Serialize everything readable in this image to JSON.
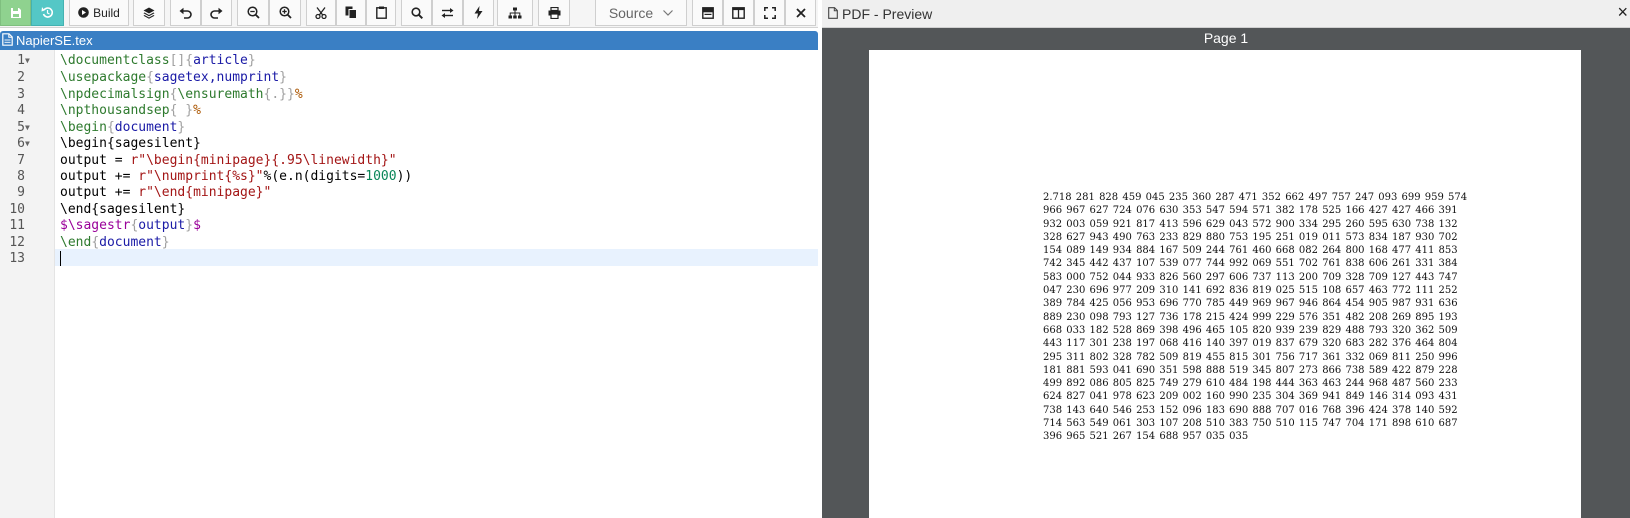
{
  "toolbar": {
    "build_label": "Build",
    "source_label": "Source",
    "icons": [
      "save-icon",
      "revert-icon",
      "play-icon",
      "layers-icon",
      "undo-icon",
      "redo-icon",
      "zoom-out-icon",
      "zoom-in-icon",
      "cut-icon",
      "copy-icon",
      "paste-icon",
      "search-icon",
      "swap-icon",
      "bolt-icon",
      "sitemap-icon",
      "print-icon",
      "chevron-down-icon",
      "single-pane-icon",
      "split-pane-icon",
      "fullscreen-icon",
      "close-icon"
    ]
  },
  "editor": {
    "filename": "NapierSE.tex",
    "line_numbers": [
      "1",
      "2",
      "3",
      "4",
      "5",
      "6",
      "7",
      "8",
      "9",
      "10",
      "11",
      "12",
      "13"
    ],
    "fold_lines": [
      "1",
      "5",
      "6"
    ]
  },
  "preview": {
    "title": "PDF - Preview",
    "page_label": "Page 1",
    "digit_lines": [
      "2.718 281 828 459 045 235 360 287 471 352 662 497 757 247 093 699 959 574",
      "966 967 627 724 076 630 353 547 594 571 382 178 525 166 427 427 466 391",
      "932 003 059 921 817 413 596 629 043 572 900 334 295 260 595 630 738 132",
      "328 627 943 490 763 233 829 880 753 195 251 019 011 573 834 187 930 702",
      "154 089 149 934 884 167 509 244 761 460 668 082 264 800 168 477 411 853",
      "742 345 442 437 107 539 077 744 992 069 551 702 761 838 606 261 331 384",
      "583 000 752 044 933 826 560 297 606 737 113 200 709 328 709 127 443 747",
      "047 230 696 977 209 310 141 692 836 819 025 515 108 657 463 772 111 252",
      "389 784 425 056 953 696 770 785 449 969 967 946 864 454 905 987 931 636",
      "889 230 098 793 127 736 178 215 424 999 229 576 351 482 208 269 895 193",
      "668 033 182 528 869 398 496 465 105 820 939 239 829 488 793 320 362 509",
      "443 117 301 238 197 068 416 140 397 019 837 679 320 683 282 376 464 804",
      "295 311 802 328 782 509 819 455 815 301 756 717 361 332 069 811 250 996",
      "181 881 593 041 690 351 598 888 519 345 807 273 866 738 589 422 879 228",
      "499 892 086 805 825 749 279 610 484 198 444 363 463 244 968 487 560 233",
      "624 827 041 978 623 209 002 160 990 235 304 369 941 849 146 314 093 431",
      "738 143 640 546 253 152 096 183 690 888 707 016 768 396 424 378 140 592",
      "714 563 549 061 303 107 208 510 383 750 510 115 747 704 171 898 610 687",
      "396 965 521 267 154 688 957 035 035"
    ]
  }
}
